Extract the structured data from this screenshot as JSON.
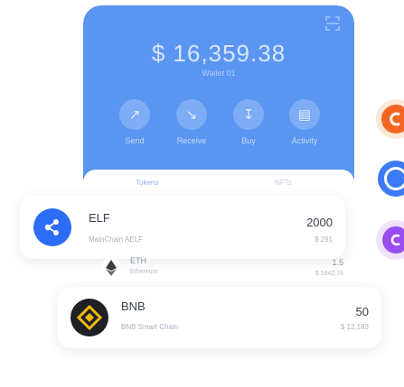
{
  "wallet": {
    "balance": "$ 16,359.38",
    "name": "Wallet 01"
  },
  "actions": [
    {
      "label": "Send",
      "icon": "send-icon"
    },
    {
      "label": "Receive",
      "icon": "receive-icon"
    },
    {
      "label": "Buy",
      "icon": "buy-icon"
    },
    {
      "label": "Activity",
      "icon": "activity-icon"
    }
  ],
  "tabs": [
    {
      "label": "Tokens",
      "active": true
    },
    {
      "label": "NFTs",
      "active": false
    }
  ],
  "tokens": [
    {
      "symbol": "ELF",
      "chain": "MainChain AELF",
      "amount": "2000",
      "usd": "$ 291",
      "icon": "elf-coin-icon",
      "color": "#2d6df6"
    },
    {
      "symbol": "ETH",
      "chain": "Ethereum",
      "amount": "1.5",
      "usd": "$ 1842.76",
      "icon": "eth-coin-icon",
      "color": "#3c3c3d"
    },
    {
      "symbol": "BNB",
      "chain": "BNB Smart Chain",
      "amount": "50",
      "usd": "$ 12,183",
      "icon": "bnb-coin-icon",
      "color": "#1e2026"
    }
  ],
  "colors": {
    "hero": "#5a95f2",
    "accent": "#8fb5f3",
    "bnb_yellow": "#f0b90b"
  }
}
